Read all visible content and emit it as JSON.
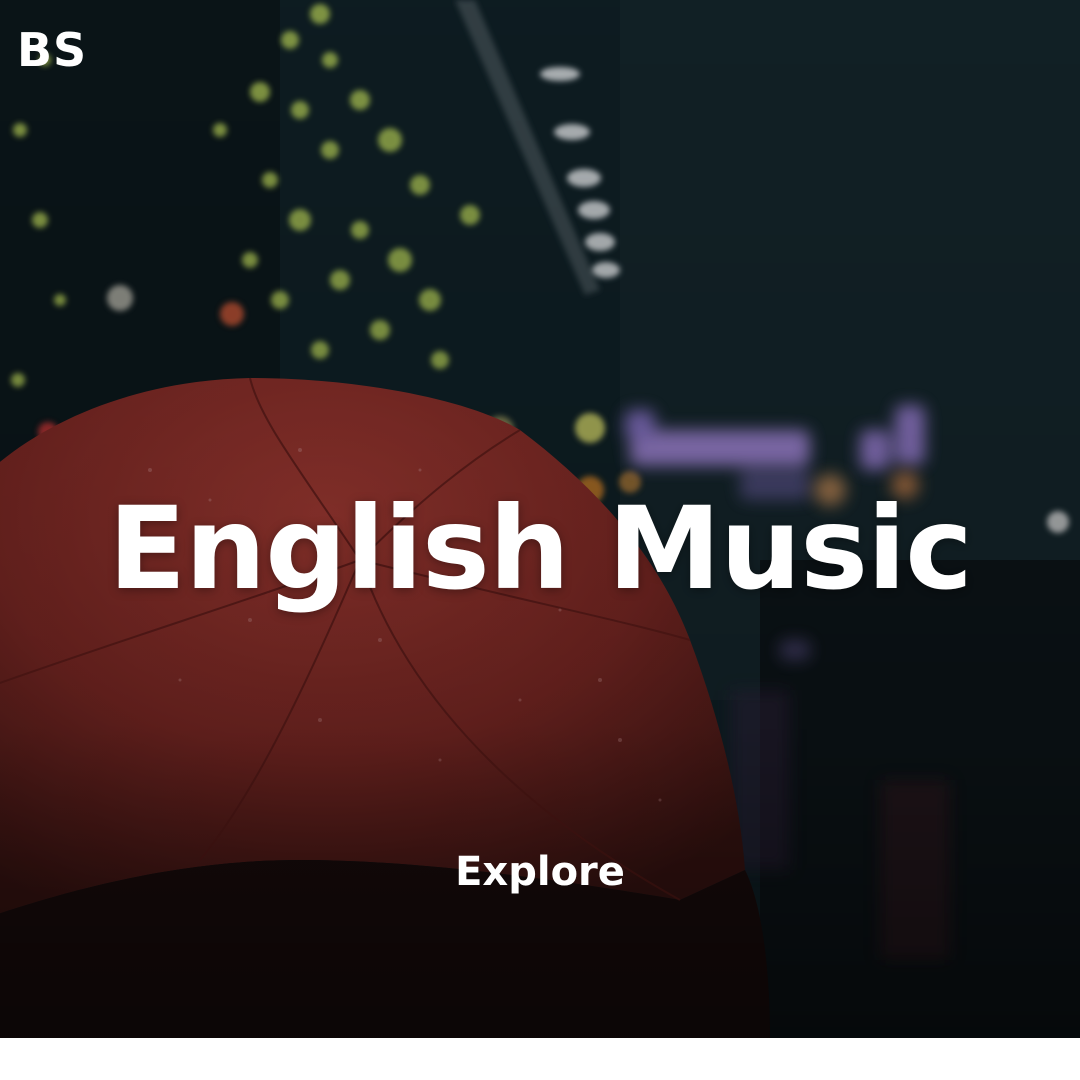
{
  "brand": {
    "logo_text": "BS"
  },
  "hero": {
    "title": "English Music",
    "cta_label": "Explore",
    "background_image": "red-umbrella-rainy-night-bokeh"
  },
  "colors": {
    "text": "#ffffff",
    "background_dark": "#0f1a1e",
    "umbrella_red": "#8a2e2a",
    "bokeh_green": "#b7d15a",
    "neon_purple": "#a88be0",
    "footer": "#ffffff"
  }
}
